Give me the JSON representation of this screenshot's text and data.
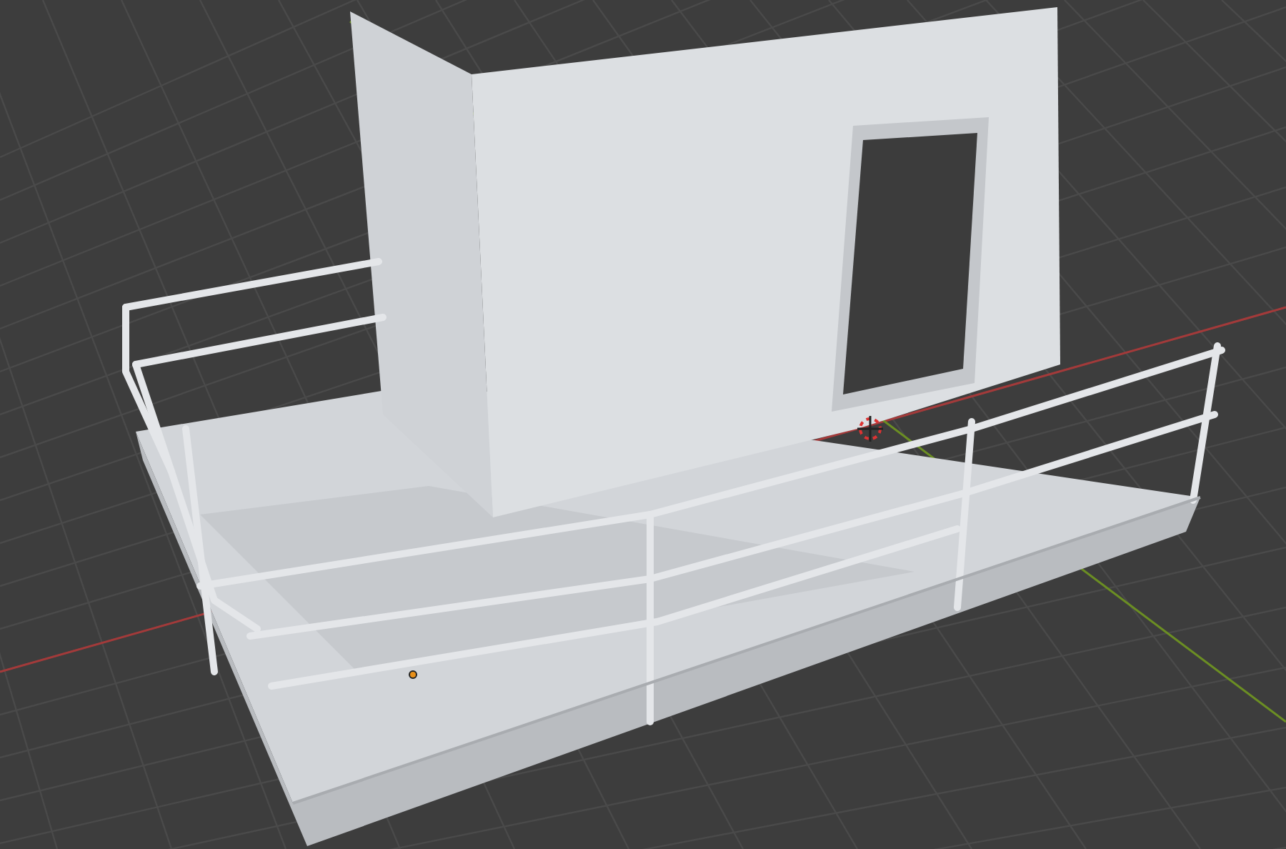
{
  "viewport": {
    "axis_lines": [
      {
        "kind": "x",
        "color": "#a33a3a"
      },
      {
        "kind": "y",
        "color": "#6b8e23"
      }
    ]
  }
}
